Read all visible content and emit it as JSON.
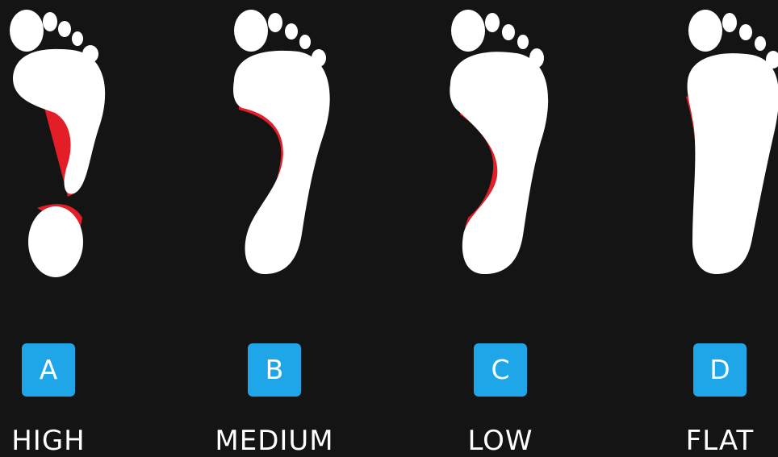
{
  "colors": {
    "background": "#141414",
    "foot": "#ffffff",
    "arch_outline": "#e41e26",
    "badge": "#1ea6e8",
    "text": "#ffffff"
  },
  "arch_types": [
    {
      "letter": "A",
      "label": "HIGH"
    },
    {
      "letter": "B",
      "label": "MEDIUM"
    },
    {
      "letter": "C",
      "label": "LOW"
    },
    {
      "letter": "D",
      "label": "FLAT"
    }
  ]
}
